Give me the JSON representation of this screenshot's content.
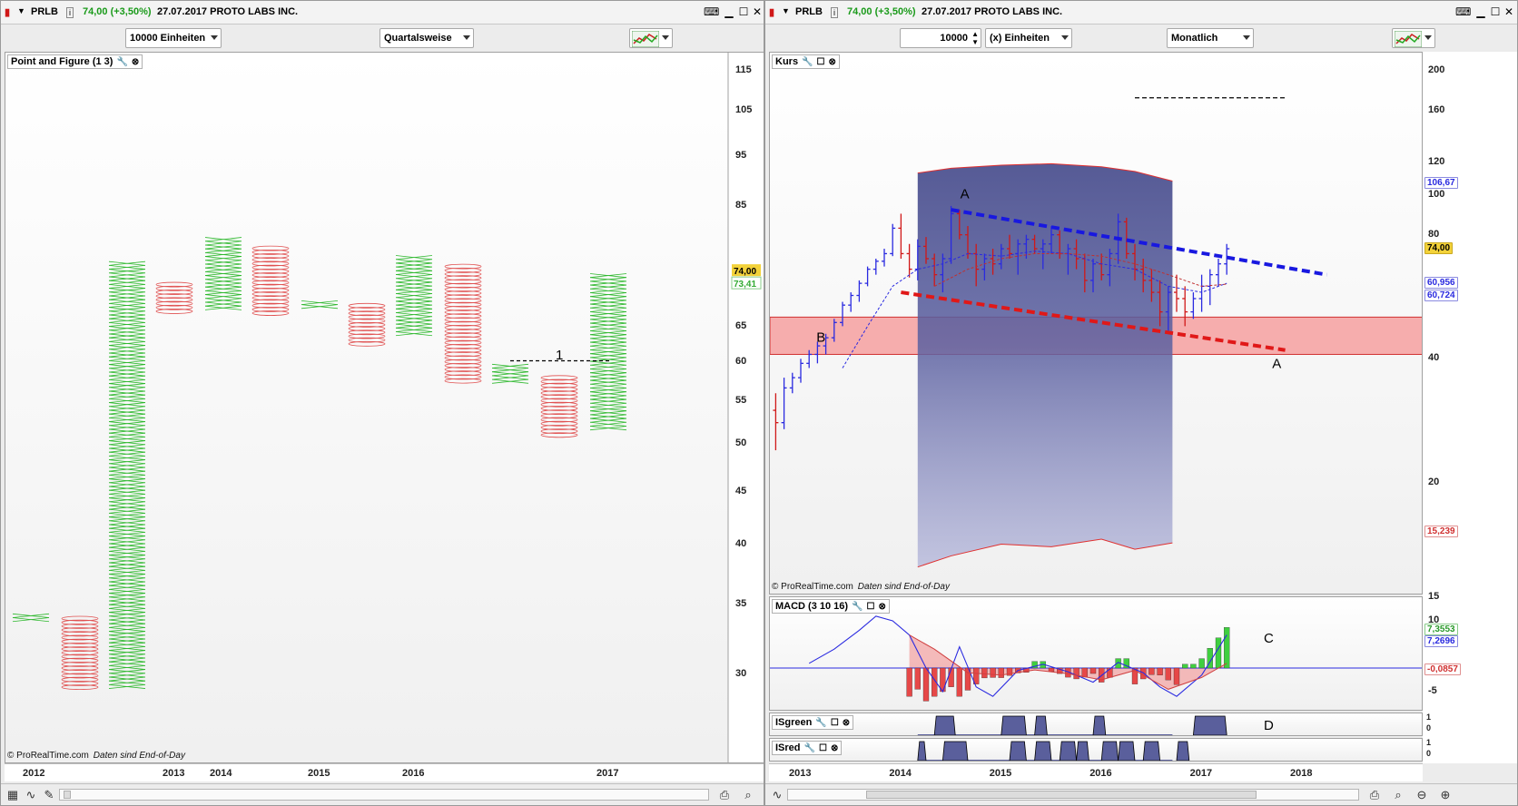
{
  "left_window": {
    "symbol": "PRLB",
    "price": "74,00 (+3,50%)",
    "date_name": "27.07.2017 PROTO LABS INC.",
    "units_dropdown": "10000 Einheiten",
    "period_dropdown": "Quartalsweise",
    "panel_label": "Point and Figure (1 3)",
    "copyright": "© ProRealTime.com",
    "copyright_note": "Daten sind End-of-Day",
    "badge_price": "74,00",
    "badge_price2": "73,41",
    "annotation_1": "1",
    "y_ticks": [
      "115",
      "105",
      "95",
      "85",
      "65",
      "60",
      "55",
      "50",
      "45",
      "40",
      "35",
      "30"
    ],
    "x_ticks": [
      "2012",
      "2013",
      "2014",
      "2015",
      "2016",
      "2017"
    ]
  },
  "right_window": {
    "symbol": "PRLB",
    "price": "74,00 (+3,50%)",
    "date_name": "27.07.2017 PROTO LABS INC.",
    "units_value": "10000",
    "units_dropdown": "(x) Einheiten",
    "period_dropdown": "Monatlich",
    "panel_kurs": "Kurs",
    "panel_macd": "MACD (3 10 16)",
    "panel_isgreen": "ISgreen",
    "panel_isred": "ISred",
    "copyright": "© ProRealTime.com",
    "copyright_note": "Daten sind End-of-Day",
    "price_ticks": [
      "200",
      "160",
      "120",
      "100",
      "80",
      "60",
      "40",
      "20"
    ],
    "badge_upper": "106,67",
    "badge_price": "74,00",
    "badge_ma1": "60,956",
    "badge_ma2": "60,724",
    "badge_lower": "15,239",
    "macd_ticks": [
      "15",
      "10",
      "5",
      "-5"
    ],
    "macd_badge1": "7,3553",
    "macd_badge2": "7,2696",
    "macd_badge3": "-0,0857",
    "is_ticks_green": [
      "1",
      "0"
    ],
    "is_ticks_red": [
      "1",
      "0"
    ],
    "label_A1": "A",
    "label_A2": "A",
    "label_B": "B",
    "label_C": "C",
    "label_D": "D",
    "x_ticks": [
      "2013",
      "2014",
      "2015",
      "2016",
      "2017",
      "2018"
    ]
  },
  "colors": {
    "up": "#2a2ae0",
    "down": "#d01818",
    "pf_x": "#2db82d",
    "pf_o": "#e05050",
    "band_fill": "#5a5f9c",
    "zone": "#f6a0a0"
  }
}
